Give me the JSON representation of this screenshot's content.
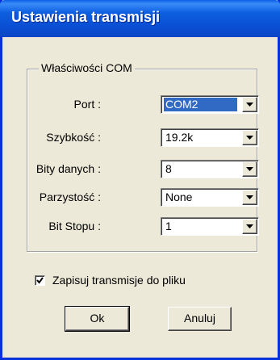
{
  "window": {
    "title": "Ustawienia transmisji"
  },
  "group": {
    "legend": "Właściwości COM",
    "fields": [
      {
        "label": "Port :",
        "value": "COM2",
        "selected": true
      },
      {
        "label": "Szybkość :",
        "value": "19.2k",
        "selected": false
      },
      {
        "label": "Bity danych :",
        "value": "8",
        "selected": false
      },
      {
        "label": "Parzystość :",
        "value": "None",
        "selected": false
      },
      {
        "label": "Bit Stopu :",
        "value": "1",
        "selected": false
      }
    ]
  },
  "save_to_file": {
    "label": "Zapisuj transmisje do pliku",
    "checked": true
  },
  "buttons": {
    "ok": "Ok",
    "cancel": "Anuluj"
  },
  "icons": {
    "dropdown": "chevron-down-icon",
    "check": "checkmark-icon"
  },
  "colors": {
    "title_bar": "#0a5fe8",
    "selection": "#316ac5",
    "window_bg": "#ece9d8"
  }
}
